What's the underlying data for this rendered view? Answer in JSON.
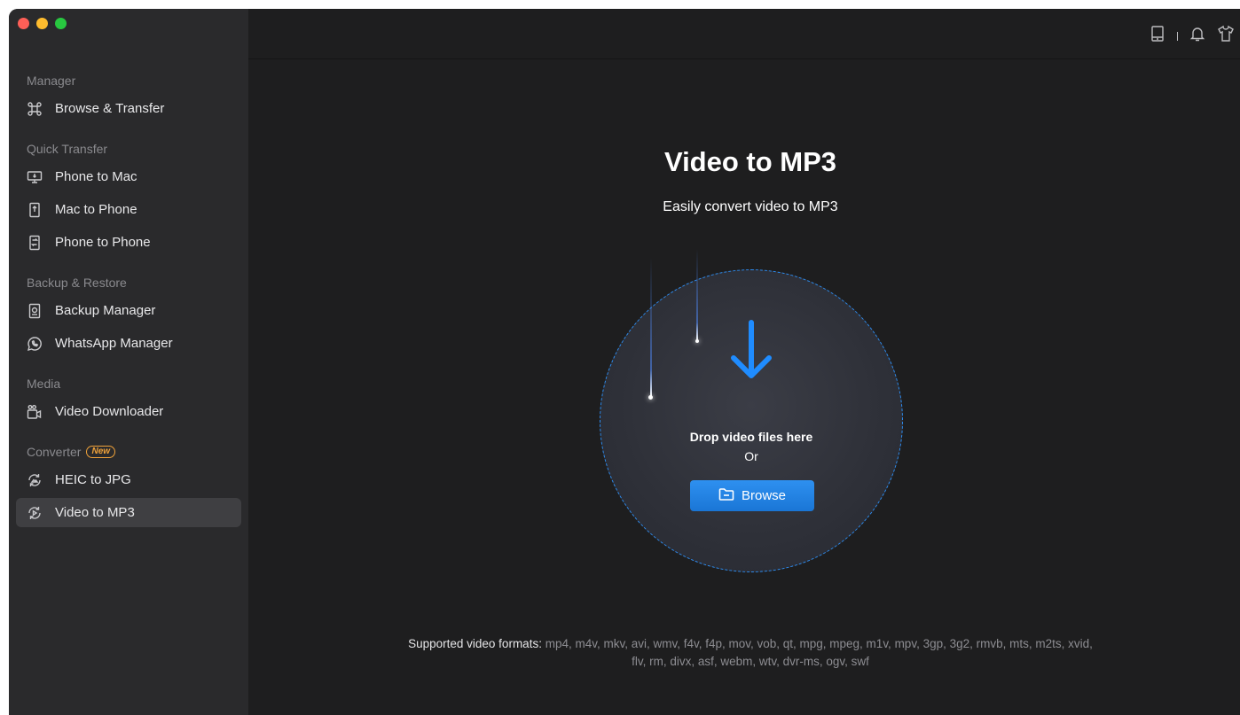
{
  "sidebar": {
    "sections": [
      {
        "label": "Manager",
        "items": [
          {
            "label": "Browse & Transfer",
            "icon": "command-icon"
          }
        ]
      },
      {
        "label": "Quick Transfer",
        "items": [
          {
            "label": "Phone to Mac",
            "icon": "monitor-icon"
          },
          {
            "label": "Mac to Phone",
            "icon": "phone-icon"
          },
          {
            "label": "Phone to Phone",
            "icon": "phones-icon"
          }
        ]
      },
      {
        "label": "Backup & Restore",
        "items": [
          {
            "label": "Backup Manager",
            "icon": "backup-icon"
          },
          {
            "label": "WhatsApp Manager",
            "icon": "whatsapp-icon"
          }
        ]
      },
      {
        "label": "Media",
        "items": [
          {
            "label": "Video Downloader",
            "icon": "video-camera-icon"
          }
        ]
      },
      {
        "label": "Converter",
        "badge": "New",
        "items": [
          {
            "label": "HEIC to JPG",
            "icon": "image-convert-icon"
          },
          {
            "label": "Video to MP3",
            "icon": "video-convert-icon",
            "active": true
          }
        ]
      }
    ]
  },
  "topbar": {
    "icons": [
      "device-icon",
      "bell-icon",
      "shirt-icon"
    ]
  },
  "main": {
    "title": "Video to MP3",
    "subtitle": "Easily convert video to MP3",
    "drop_text": "Drop video files here",
    "or_text": "Or",
    "browse_label": "Browse",
    "formats_label": "Supported video formats:",
    "formats_list": " mp4, m4v, mkv, avi, wmv, f4v, f4p, mov, vob, qt, mpg, mpeg, m1v, mpv, 3gp, 3g2, rmvb, mts, m2ts, xvid, flv, rm, divx, asf, webm, wtv, dvr-ms, ogv, swf"
  },
  "colors": {
    "accent": "#2d8cf0",
    "badge": "#f0a23a",
    "sidebar_bg": "#2a2a2c",
    "main_bg": "#1e1e1f"
  }
}
